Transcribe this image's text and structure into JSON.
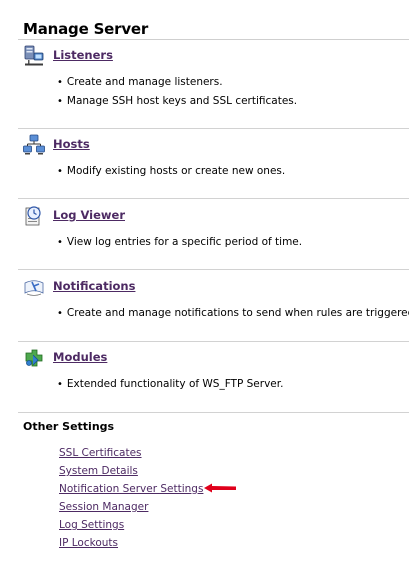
{
  "page": {
    "title": "Manage Server"
  },
  "sections": [
    {
      "title": "Listeners",
      "icon": "server-network-icon",
      "items": [
        "Create and manage listeners.",
        "Manage SSH host keys and SSL certificates."
      ]
    },
    {
      "title": "Hosts",
      "icon": "hosts-network-icon",
      "items": [
        "Modify existing hosts or create new ones."
      ]
    },
    {
      "title": "Log Viewer",
      "icon": "log-viewer-icon",
      "items": [
        "View log entries for a specific period of time."
      ]
    },
    {
      "title": "Notifications",
      "icon": "notifications-icon",
      "items": [
        "Create and manage notifications to send when rules are triggered."
      ]
    },
    {
      "title": "Modules",
      "icon": "modules-icon",
      "items": [
        "Extended functionality of WS_FTP Server."
      ]
    }
  ],
  "other_settings": {
    "title": "Other Settings",
    "links": [
      "SSL Certificates",
      "System Details",
      "Notification Server Settings",
      "Session Manager",
      "Log Settings",
      "IP Lockouts"
    ]
  },
  "colors": {
    "link": "#4d2a63",
    "divider": "#d2d2d2",
    "annotation_arrow": "#e0001b"
  }
}
